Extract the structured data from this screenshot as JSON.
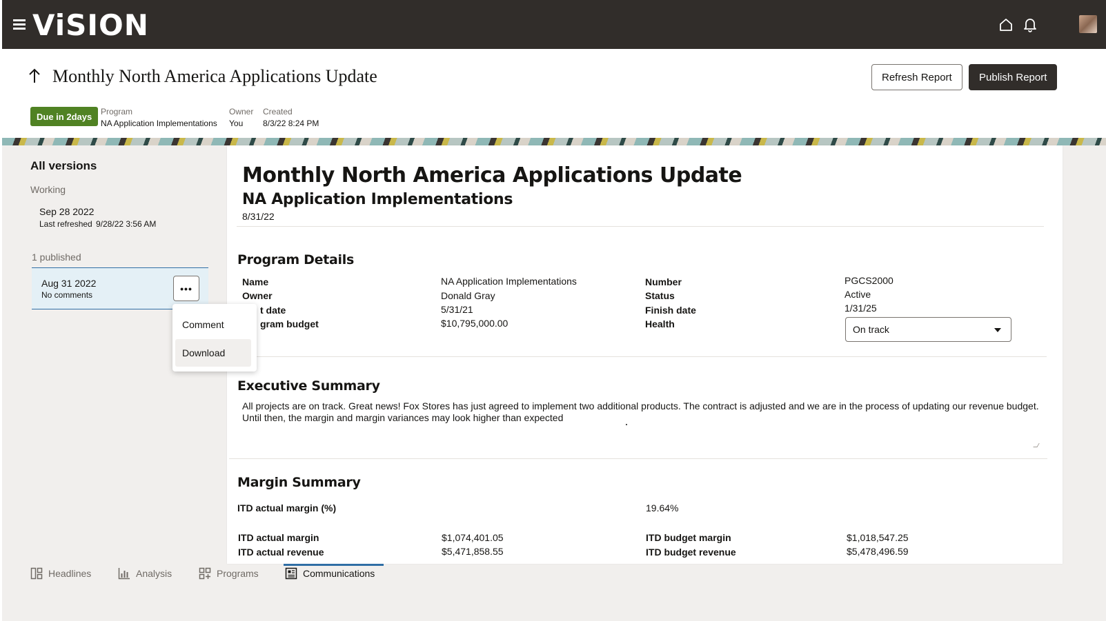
{
  "app": {
    "logo": "ViSION"
  },
  "header": {
    "title": "Monthly North America Applications Update",
    "refresh_label": "Refresh Report",
    "publish_label": "Publish Report",
    "due_badge": "Due in 2days",
    "program_label": "Program",
    "program_value": "NA Application Implementations",
    "owner_label": "Owner",
    "owner_value": "You",
    "created_label": "Created",
    "created_value": "8/3/22 8:24 PM"
  },
  "versions": {
    "title": "All versions",
    "working_label": "Working",
    "working_date": "Sep 28  2022",
    "working_refreshed_label": "Last refreshed",
    "working_refreshed_value": "9/28/22 3:56 AM",
    "published_label": "1 published",
    "published_date": "Aug 31  2022",
    "published_comments": "No comments",
    "more_label": "•••",
    "menu": [
      {
        "label": "Comment"
      },
      {
        "label": "Download"
      }
    ]
  },
  "report": {
    "title": "Monthly North America Applications Update",
    "subtitle": "NA Application Implementations",
    "date": "8/31/22",
    "program_details": {
      "heading": "Program Details",
      "name_label": "Name",
      "name_value": "NA Application Implementations",
      "owner_label": "Owner",
      "owner_value": "Donald Gray",
      "start_label": "t date",
      "start_value": "5/31/21",
      "budget_label": "gram budget",
      "budget_value": "$10,795,000.00",
      "number_label": "Number",
      "number_value": "PGCS2000",
      "status_label": "Status",
      "status_value": "Active",
      "finish_label": "Finish date",
      "finish_value": "1/31/25",
      "health_label": "Health",
      "health_value": "On track"
    },
    "executive_summary": {
      "heading": "Executive Summary",
      "text": "All projects are on track. Great news! Fox Stores has just agreed to implement two additional products. The contract is adjusted and we are in the process of updating our revenue budget. Until then, the margin and margin variances may look higher than expected"
    },
    "margin_summary": {
      "heading": "Margin Summary",
      "itd_margin_pct_label": "ITD actual margin (%)",
      "itd_margin_pct_value": "19.64%",
      "itd_actual_margin_label": "ITD actual margin",
      "itd_actual_margin_value": "$1,074,401.05",
      "itd_actual_revenue_label": "ITD actual revenue",
      "itd_actual_revenue_value": "$5,471,858.55",
      "itd_budget_margin_label": "ITD budget margin",
      "itd_budget_margin_value": "$1,018,547.25",
      "itd_budget_revenue_label": "ITD budget revenue",
      "itd_budget_revenue_value": "$5,478,496.59"
    }
  },
  "tabs": [
    {
      "label": "Headlines",
      "icon": "headlines-icon"
    },
    {
      "label": "Analysis",
      "icon": "analysis-icon"
    },
    {
      "label": "Programs",
      "icon": "programs-icon"
    },
    {
      "label": "Communications",
      "icon": "communications-icon",
      "active": true
    }
  ],
  "colors": {
    "topbar": "#312d2a",
    "badge_green": "#508223",
    "accent_blue": "#2f6ea5",
    "selected_card": "#e4f0f6"
  }
}
